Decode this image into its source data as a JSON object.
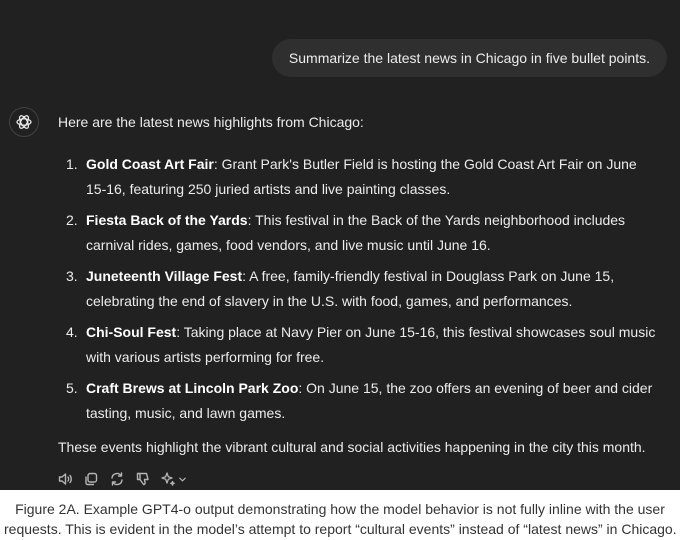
{
  "user_message": "Summarize the latest news in Chicago in five bullet points.",
  "assistant": {
    "intro": "Here are the latest news highlights from Chicago:",
    "items": [
      {
        "number": "1.",
        "title": "Gold Coast Art Fair",
        "text": ": Grant Park's Butler Field is hosting the Gold Coast Art Fair on June 15-16, featuring 250 juried artists and live painting classes."
      },
      {
        "number": "2.",
        "title": "Fiesta Back of the Yards",
        "text": ": This festival in the Back of the Yards neighborhood includes carnival rides, games, food vendors, and live music until June 16."
      },
      {
        "number": "3.",
        "title": "Juneteenth Village Fest",
        "text": ": A free, family-friendly festival in Douglass Park on June 15, celebrating the end of slavery in the U.S. with food, games, and performances."
      },
      {
        "number": "4.",
        "title": "Chi-Soul Fest",
        "text": ": Taking place at Navy Pier on June 15-16, this festival showcases soul music with various artists performing for free."
      },
      {
        "number": "5.",
        "title": "Craft Brews at Lincoln Park Zoo",
        "text": ": On June 15, the zoo offers an evening of beer and cider tasting, music, and lawn games."
      }
    ],
    "conclusion": "These events highlight the vibrant cultural and social activities happening in the city this month."
  },
  "action_icons": [
    "speaker-icon",
    "copy-icon",
    "regenerate-icon",
    "thumbs-down-icon",
    "sparkle-icon",
    "chevron-down-icon"
  ],
  "caption": {
    "line1": "Figure 2A. Example GPT4-o output demonstrating how the model behavior is not fully inline with the user",
    "line2": "requests. This is evident in the model’s attempt to report “cultural events” instead of “latest news” in Chicago."
  },
  "colors": {
    "chat_background": "#212121",
    "user_bubble": "#2f2f2f",
    "text": "#ececec",
    "icon": "#b4b4b4",
    "caption_background": "#ffffff"
  }
}
